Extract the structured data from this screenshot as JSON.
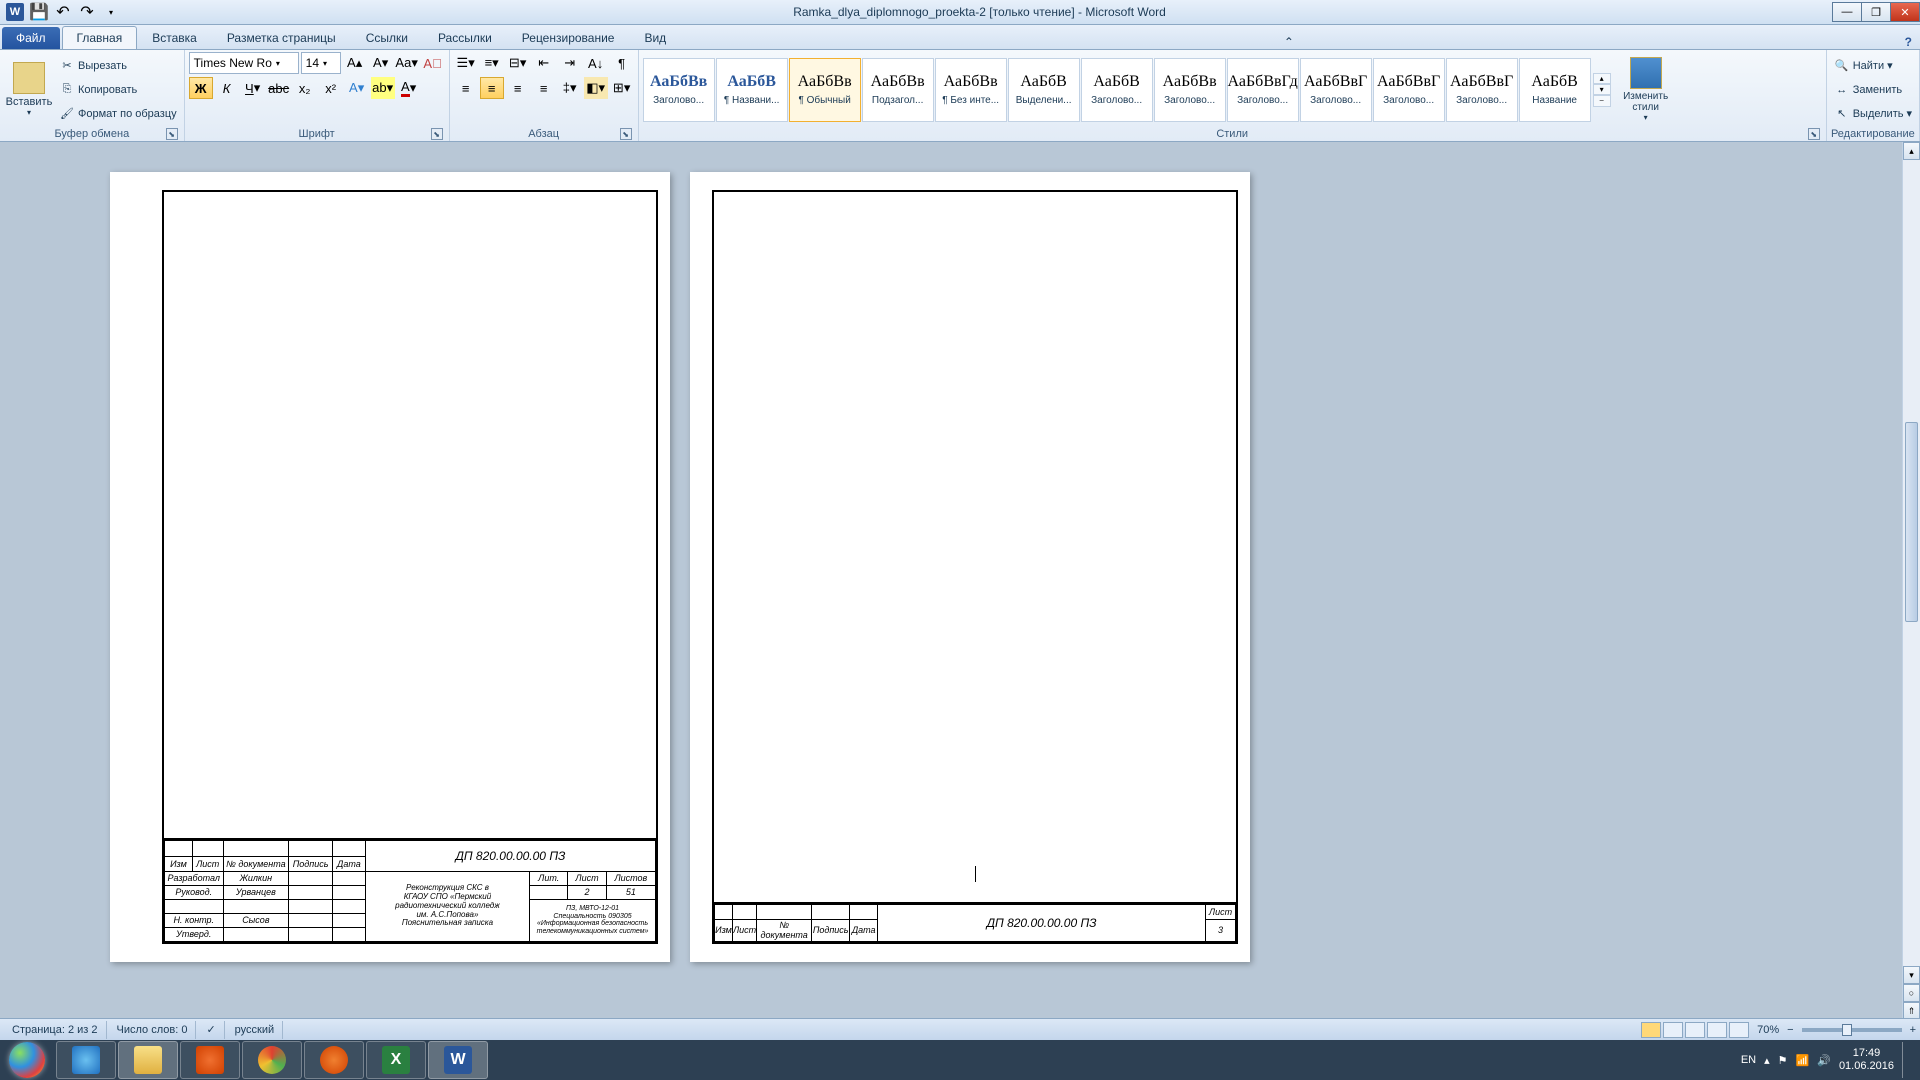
{
  "titlebar": {
    "title": "Ramka_dlya_diplomnogo_proekta-2 [только чтение] - Microsoft Word",
    "word": "W"
  },
  "tabs": {
    "file": "Файл",
    "items": [
      "Главная",
      "Вставка",
      "Разметка страницы",
      "Ссылки",
      "Рассылки",
      "Рецензирование",
      "Вид"
    ]
  },
  "clipboard": {
    "paste": "Вставить",
    "cut": "Вырезать",
    "copy": "Копировать",
    "format": "Формат по образцу",
    "label": "Буфер обмена"
  },
  "font": {
    "name": "Times New Ro",
    "size": "14",
    "label": "Шрифт"
  },
  "para": {
    "label": "Абзац"
  },
  "styles": {
    "label": "Стили",
    "change": "Изменить стили",
    "items": [
      {
        "preview": "АаБбВв",
        "name": "Заголово..."
      },
      {
        "preview": "АаБбВ",
        "name": "¶ Названи..."
      },
      {
        "preview": "АаБбВв",
        "name": "¶ Обычный",
        "sel": true
      },
      {
        "preview": "АаБбВв",
        "name": "Подзагол..."
      },
      {
        "preview": "АаБбВв",
        "name": "¶ Без инте..."
      },
      {
        "preview": "АаБбВ",
        "name": "Выделени..."
      },
      {
        "preview": "АаБбВ",
        "name": "Заголово..."
      },
      {
        "preview": "АаБбВв",
        "name": "Заголово..."
      },
      {
        "preview": "АаБбВвГд",
        "name": "Заголово..."
      },
      {
        "preview": "АаБбВвГ",
        "name": "Заголово..."
      },
      {
        "preview": "АаБбВвГ",
        "name": "Заголово..."
      },
      {
        "preview": "АаБбВвГ",
        "name": "Заголово..."
      },
      {
        "preview": "АаБбВ",
        "name": "Название"
      }
    ]
  },
  "editing": {
    "find": "Найти",
    "replace": "Заменить",
    "select": "Выделить",
    "label": "Редактирование"
  },
  "doc": {
    "code": "ДП 820.00.00.00 ПЗ",
    "p1": {
      "h": [
        "Изм",
        "Лист",
        "№ документа",
        "Подпись",
        "Дата"
      ],
      "rows": [
        [
          "Разработал",
          "Жилкин"
        ],
        [
          "Руковод.",
          "Урванцев"
        ],
        [
          "",
          ""
        ],
        [
          "Н. контр.",
          "Сысов"
        ],
        [
          "Утверд.",
          ""
        ]
      ],
      "desc1": "Реконструкция СКС в",
      "desc2": "КГАОУ СПО «Пермский",
      "desc3": "радиотехнический колледж",
      "desc4": "им. А.С.Попова»",
      "desc5": "Пояснительная записка",
      "right1": "ПЗ, МВТО-12-01",
      "right2": "Специальность 090305",
      "right3": "«Информационная безопасность",
      "right4": "телекоммуникационных систем»",
      "lit": "Лит.",
      "list": "Лист",
      "listov": "Листов",
      "page": "2",
      "pages": "51"
    },
    "p2": {
      "h": [
        "Изм",
        "Лист",
        "№ документа",
        "Подпись",
        "Дата"
      ],
      "list": "Лист",
      "page": "3"
    }
  },
  "status": {
    "page": "Страница: 2 из 2",
    "words": "Число слов: 0",
    "lang": "русский",
    "zoom": "70%"
  },
  "tray": {
    "lang": "EN",
    "time": "17:49",
    "date": "01.06.2016"
  }
}
